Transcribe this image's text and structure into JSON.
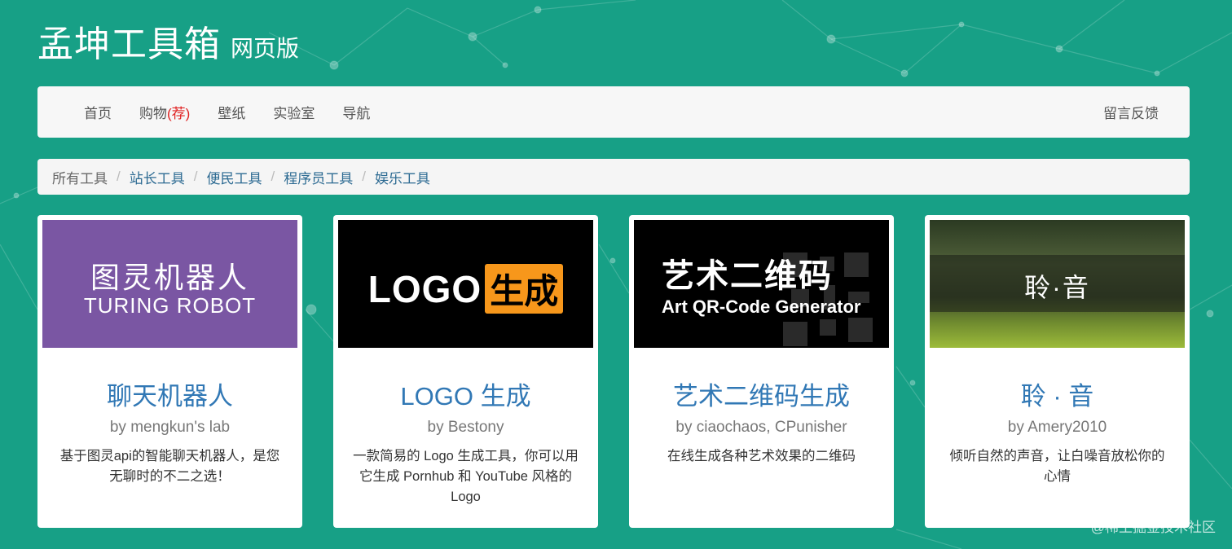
{
  "header": {
    "title": "孟坤工具箱",
    "subtitle": "网页版"
  },
  "nav": {
    "items": [
      {
        "label": "首页"
      },
      {
        "label": "购物",
        "badge": "(荐)"
      },
      {
        "label": "壁纸"
      },
      {
        "label": "实验室"
      },
      {
        "label": "导航"
      }
    ],
    "feedback": "留言反馈"
  },
  "breadcrumb": {
    "active": "所有工具",
    "links": [
      "站长工具",
      "便民工具",
      "程序员工具",
      "娱乐工具"
    ]
  },
  "cards": [
    {
      "thumb_line1": "图灵机器人",
      "thumb_line2": "TURING ROBOT",
      "title": "聊天机器人",
      "author": "by mengkun's lab",
      "desc": "基于图灵api的智能聊天机器人，是您无聊时的不二之选！"
    },
    {
      "thumb_logo": "LOGO",
      "thumb_gen": "生成",
      "title": "LOGO 生成",
      "author": "by Bestony",
      "desc": "一款简易的 Logo 生成工具，你可以用它生成 Pornhub 和 YouTube 风格的 Logo"
    },
    {
      "thumb_line1": "艺术二维码",
      "thumb_line2": "Art QR-Code Generator",
      "title": "艺术二维码生成",
      "author": "by ciaochaos, CPunisher",
      "desc": "在线生成各种艺术效果的二维码"
    },
    {
      "thumb_text": "聆·音",
      "title": "聆 · 音",
      "author": "by Amery2010",
      "desc": "倾听自然的声音，让白噪音放松你的心情"
    }
  ],
  "watermark": "@稀土掘金技术社区",
  "colors": {
    "background": "#17a086",
    "link": "#3178b5",
    "logo_orange": "#f7971b",
    "turing_purple": "#7a56a3"
  }
}
